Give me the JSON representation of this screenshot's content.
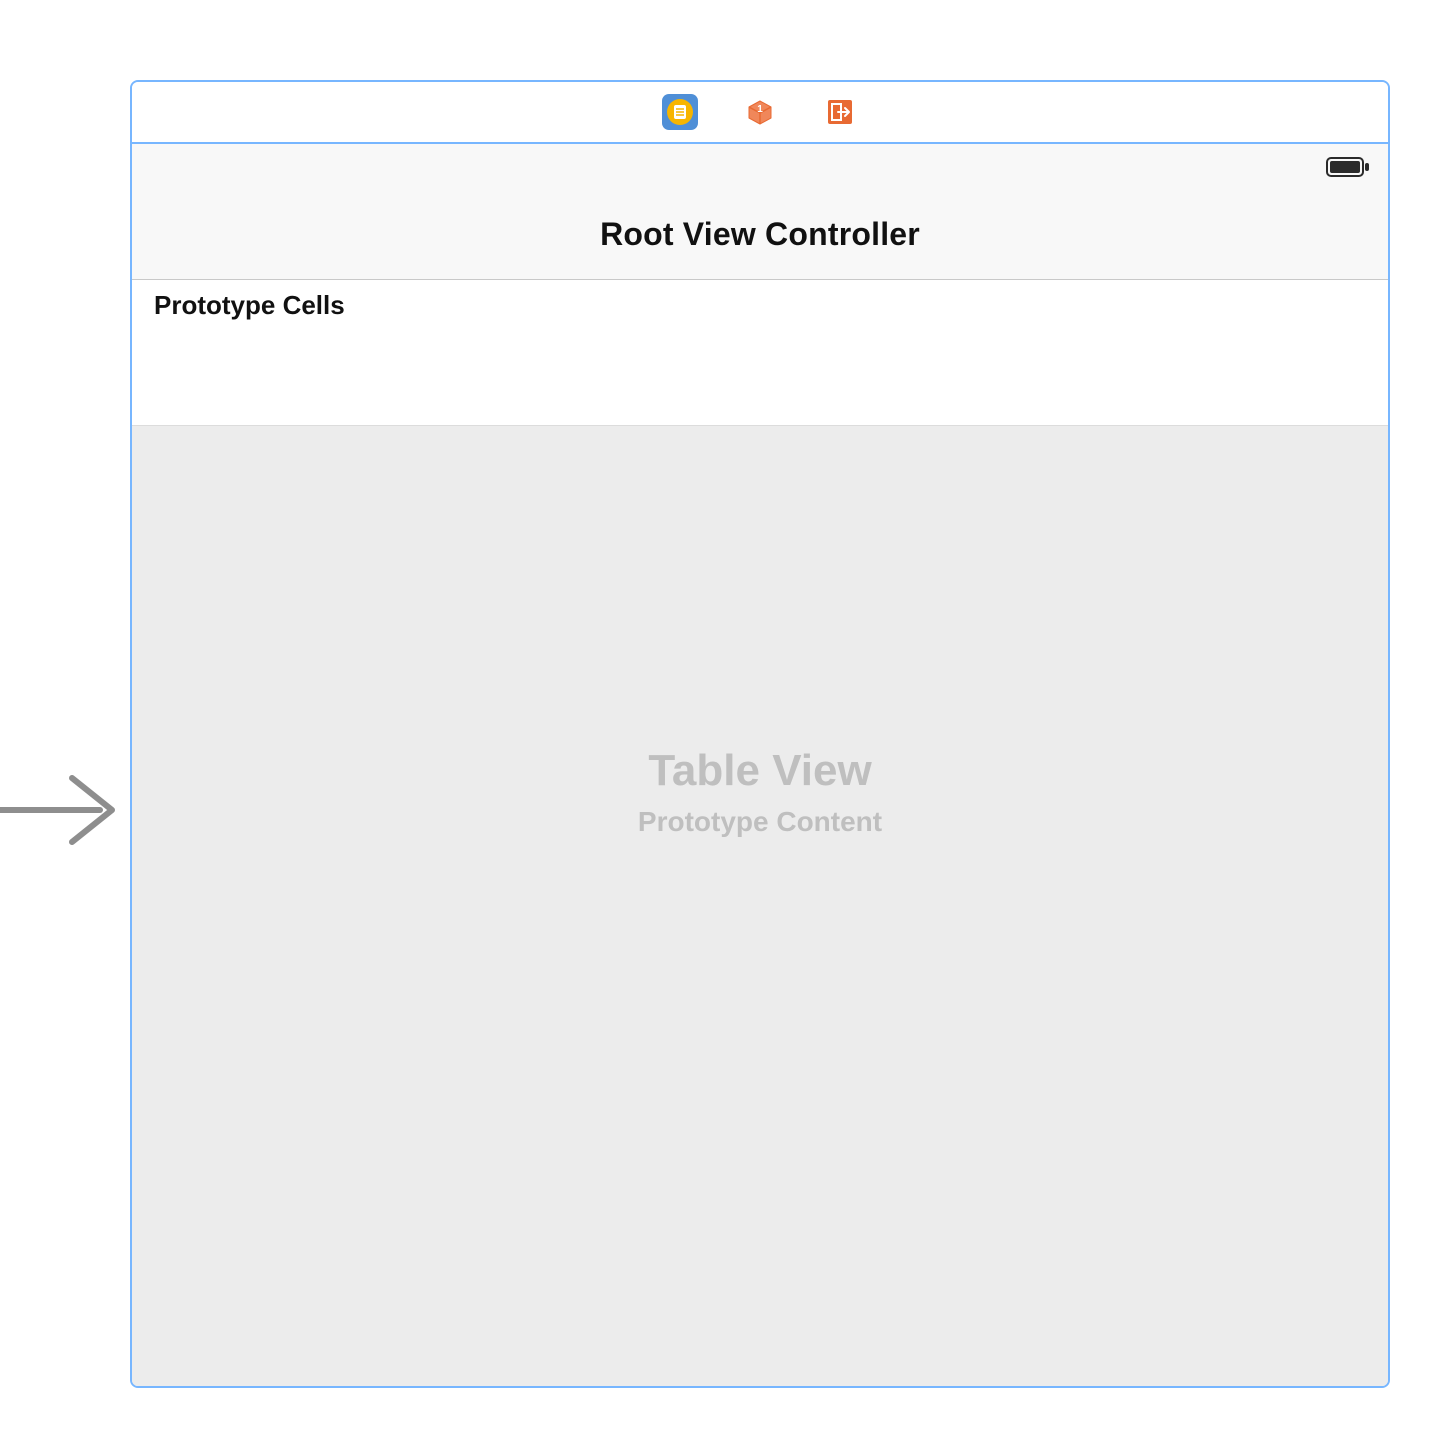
{
  "scene": {
    "nav_title": "Root View Controller",
    "prototype_header": "Prototype Cells",
    "tableview_title": "Table View",
    "tableview_subtitle": "Prototype Content"
  },
  "dock": {
    "items": [
      {
        "name": "view-controller-icon",
        "selected": true
      },
      {
        "name": "first-responder-icon",
        "selected": false
      },
      {
        "name": "exit-icon",
        "selected": false
      }
    ]
  },
  "icons": {
    "battery": "battery-icon",
    "segue": "segue-arrow-icon"
  }
}
